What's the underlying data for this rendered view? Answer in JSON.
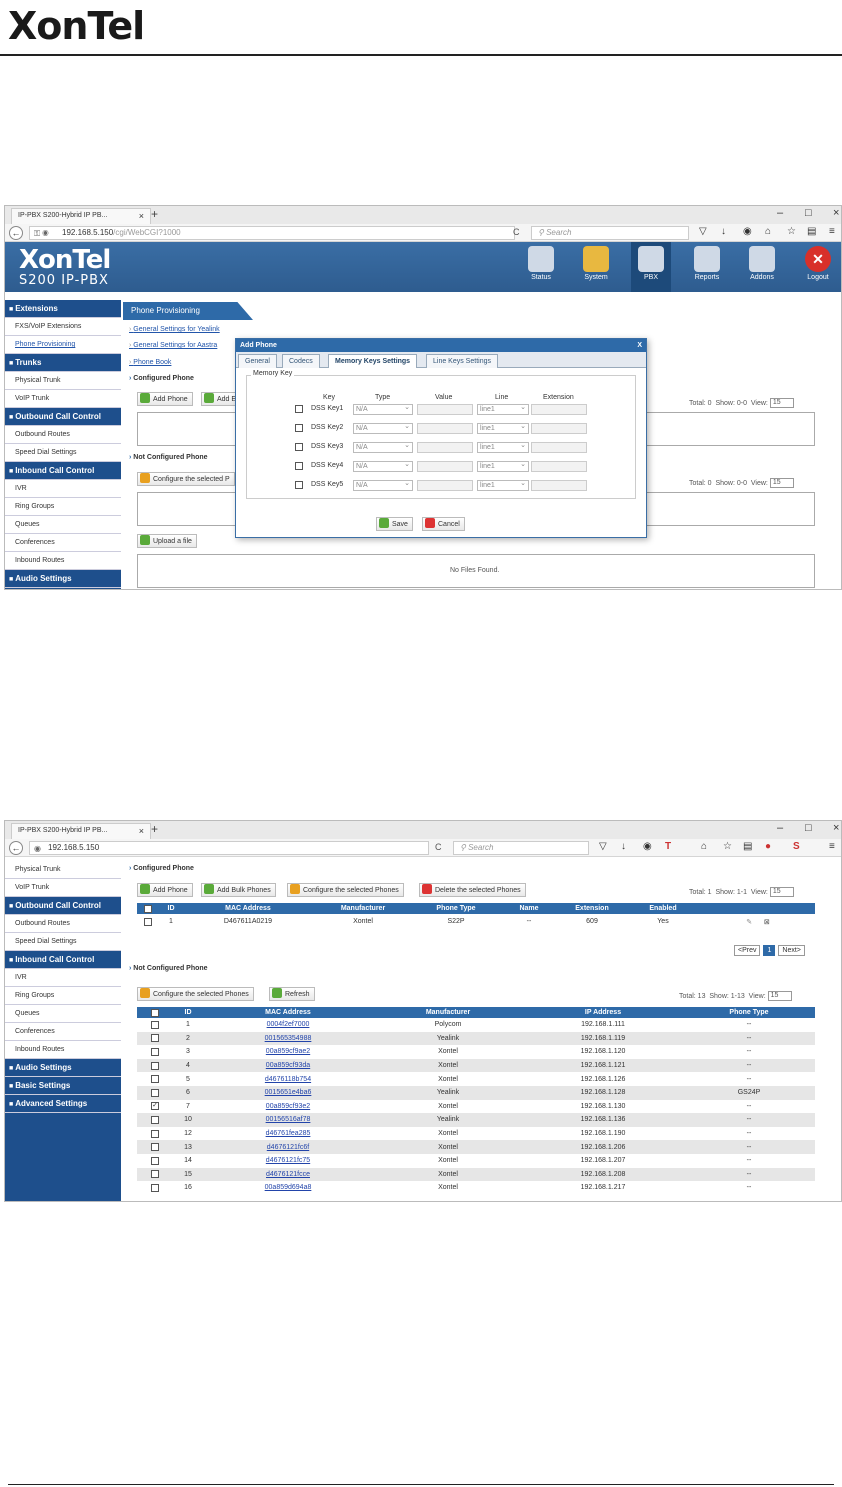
{
  "document": {
    "logo": "XonTel"
  },
  "shot1": {
    "browser": {
      "tab_title": "IP-PBX S200-Hybrid IP PB...",
      "url_host": "192.168.5.150",
      "url_path": "/cgi/WebCGI?1000",
      "search_placeholder": "Search",
      "win_min": "–",
      "win_max": "□",
      "win_close": "×"
    },
    "app": {
      "logo": "XonTel",
      "logo_sub": "S200 IP-PBX",
      "nav": [
        {
          "label": "Status"
        },
        {
          "label": "System"
        },
        {
          "label": "PBX"
        },
        {
          "label": "Reports"
        },
        {
          "label": "Addons"
        },
        {
          "label": "Logout"
        }
      ]
    },
    "sidebar": [
      {
        "label": "Extensions",
        "type": "grp"
      },
      {
        "label": "FXS/VoIP Extensions",
        "type": "item"
      },
      {
        "label": "Phone Provisioning",
        "type": "link"
      },
      {
        "label": "Trunks",
        "type": "grp"
      },
      {
        "label": "Physical Trunk",
        "type": "item"
      },
      {
        "label": "VoIP Trunk",
        "type": "item"
      },
      {
        "label": "Outbound Call Control",
        "type": "grp"
      },
      {
        "label": "Outbound Routes",
        "type": "item"
      },
      {
        "label": "Speed Dial Settings",
        "type": "item"
      },
      {
        "label": "Inbound Call Control",
        "type": "grp"
      },
      {
        "label": "IVR",
        "type": "item"
      },
      {
        "label": "Ring Groups",
        "type": "item"
      },
      {
        "label": "Queues",
        "type": "item"
      },
      {
        "label": "Conferences",
        "type": "item"
      },
      {
        "label": "Inbound Routes",
        "type": "item"
      },
      {
        "label": "Audio Settings",
        "type": "grp"
      }
    ],
    "page_title": "Phone Provisioning",
    "links": [
      "General Settings for Yealink",
      "General Settings for Aastra",
      "Phone Book"
    ],
    "configured_heading": "Configured Phone",
    "add_phone": "Add Phone",
    "add_bulk_trunc": "Add E",
    "not_configured_heading": "Not Configured Phone",
    "configure_selected_trunc": "Configure the selected P",
    "upload": "Upload a file",
    "no_files": "No Files Found.",
    "pager1": {
      "total": "Total: 0",
      "show": "Show: 0-0",
      "view_label": "View:",
      "view": "15"
    },
    "pager2": {
      "total": "Total: 0",
      "show": "Show: 0-0",
      "view_label": "View:",
      "view": "15"
    },
    "dialog": {
      "title": "Add Phone",
      "close": "X",
      "tabs": [
        "General",
        "Codecs",
        "Memory Keys Settings",
        "Line Keys Settings"
      ],
      "legend": "Memory Key",
      "headers": {
        "key": "Key",
        "type": "Type",
        "value": "Value",
        "line": "Line",
        "extension": "Extension"
      },
      "rows": [
        {
          "key": "DSS Key1",
          "type": "N/A",
          "line": "line1"
        },
        {
          "key": "DSS Key2",
          "type": "N/A",
          "line": "line1"
        },
        {
          "key": "DSS Key3",
          "type": "N/A",
          "line": "line1"
        },
        {
          "key": "DSS Key4",
          "type": "N/A",
          "line": "line1"
        },
        {
          "key": "DSS Key5",
          "type": "N/A",
          "line": "line1"
        }
      ],
      "save": "Save",
      "cancel": "Cancel"
    }
  },
  "shot2": {
    "browser": {
      "tab_title": "IP-PBX S200-Hybrid IP PB...",
      "url_host": "192.168.5.150",
      "search_placeholder": "Search",
      "win_min": "–",
      "win_max": "□",
      "win_close": "×"
    },
    "sidebar": [
      {
        "label": "Physical Trunk",
        "type": "item"
      },
      {
        "label": "VoIP Trunk",
        "type": "item"
      },
      {
        "label": "Outbound Call Control",
        "type": "grp"
      },
      {
        "label": "Outbound Routes",
        "type": "item"
      },
      {
        "label": "Speed Dial Settings",
        "type": "item"
      },
      {
        "label": "Inbound Call Control",
        "type": "grp"
      },
      {
        "label": "IVR",
        "type": "item"
      },
      {
        "label": "Ring Groups",
        "type": "item"
      },
      {
        "label": "Queues",
        "type": "item"
      },
      {
        "label": "Conferences",
        "type": "item"
      },
      {
        "label": "Inbound Routes",
        "type": "item"
      },
      {
        "label": "Audio Settings",
        "type": "grp"
      },
      {
        "label": "Basic Settings",
        "type": "grp"
      },
      {
        "label": "Advanced Settings",
        "type": "grp"
      }
    ],
    "configured_heading": "Configured Phone",
    "buttons": {
      "add_phone": "Add Phone",
      "add_bulk": "Add Bulk Phones",
      "configure": "Configure the selected Phones",
      "delete": "Delete the selected Phones",
      "configure2": "Configure the selected Phones",
      "refresh": "Refresh"
    },
    "pager1": {
      "total": "Total: 1",
      "show": "Show: 1-1",
      "view_label": "View:",
      "view": "15"
    },
    "configured_table": {
      "headers": [
        "ID",
        "MAC Address",
        "Manufacturer",
        "Phone Type",
        "Name",
        "Extension",
        "Enabled"
      ],
      "rows": [
        {
          "id": "1",
          "mac": "D467611A0219",
          "manufacturer": "Xontel",
          "type": "S22P",
          "name": "--",
          "extension": "609",
          "enabled": "Yes"
        }
      ]
    },
    "paging": {
      "prev": "<Prev",
      "page": "1",
      "next": "Next>"
    },
    "not_configured_heading": "Not Configured Phone",
    "pager2": {
      "total": "Total: 13",
      "show": "Show: 1-13",
      "view_label": "View:",
      "view": "15"
    },
    "nc_table": {
      "headers": [
        "ID",
        "MAC Address",
        "Manufacturer",
        "IP Address",
        "Phone Type"
      ],
      "rows": [
        {
          "id": "1",
          "mac": "0004f2ef7000",
          "manufacturer": "Polycom",
          "ip": "192.168.1.111",
          "type": "--",
          "checked": false
        },
        {
          "id": "2",
          "mac": "001565354988",
          "manufacturer": "Yealink",
          "ip": "192.168.1.119",
          "type": "--",
          "checked": false
        },
        {
          "id": "3",
          "mac": "00a859cf9ae2",
          "manufacturer": "Xontel",
          "ip": "192.168.1.120",
          "type": "--",
          "checked": false
        },
        {
          "id": "4",
          "mac": "00a859cf93da",
          "manufacturer": "Xontel",
          "ip": "192.168.1.121",
          "type": "--",
          "checked": false
        },
        {
          "id": "5",
          "mac": "d4676118b754",
          "manufacturer": "Xontel",
          "ip": "192.168.1.126",
          "type": "--",
          "checked": false
        },
        {
          "id": "6",
          "mac": "0015651e4ba6",
          "manufacturer": "Yealink",
          "ip": "192.168.1.128",
          "type": "GS24P",
          "checked": false
        },
        {
          "id": "7",
          "mac": "00a859cf93e2",
          "manufacturer": "Xontel",
          "ip": "192.168.1.130",
          "type": "--",
          "checked": true
        },
        {
          "id": "10",
          "mac": "00156516af78",
          "manufacturer": "Yealink",
          "ip": "192.168.1.136",
          "type": "--",
          "checked": false
        },
        {
          "id": "12",
          "mac": "d46761fea285",
          "manufacturer": "Xontel",
          "ip": "192.168.1.190",
          "type": "--",
          "checked": false
        },
        {
          "id": "13",
          "mac": "d4676121fc6f",
          "manufacturer": "Xontel",
          "ip": "192.168.1.206",
          "type": "--",
          "checked": false
        },
        {
          "id": "14",
          "mac": "d4676121fc75",
          "manufacturer": "Xontel",
          "ip": "192.168.1.207",
          "type": "--",
          "checked": false
        },
        {
          "id": "15",
          "mac": "d4676121fcce",
          "manufacturer": "Xontel",
          "ip": "192.168.1.208",
          "type": "--",
          "checked": false
        },
        {
          "id": "16",
          "mac": "00a859d694a8",
          "manufacturer": "Xontel",
          "ip": "192.168.1.217",
          "type": "--",
          "checked": false
        }
      ]
    }
  }
}
